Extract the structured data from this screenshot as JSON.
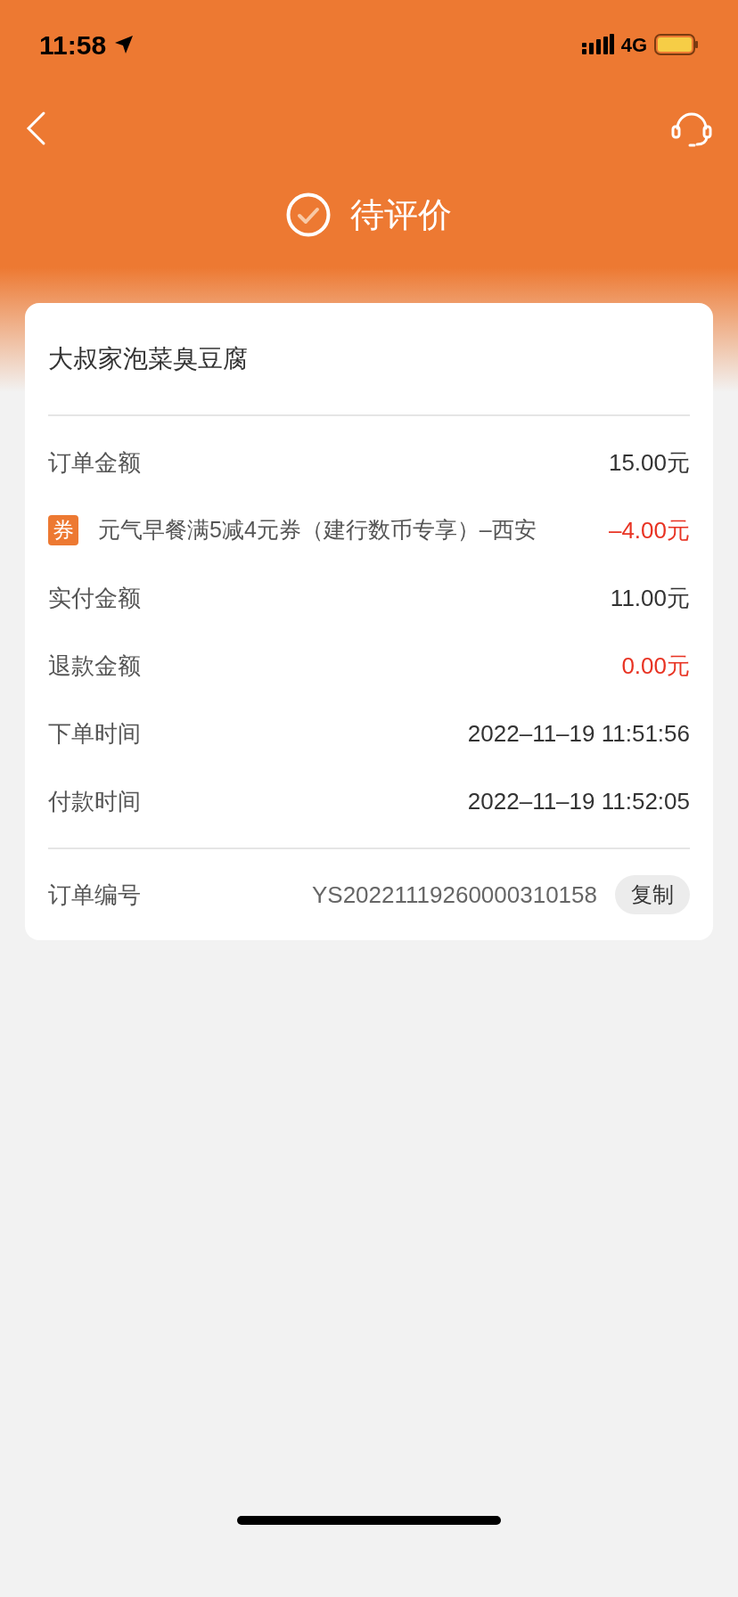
{
  "status_bar": {
    "time": "11:58",
    "network": "4G"
  },
  "header": {
    "status": "待评价"
  },
  "order": {
    "shop_name": "大叔家泡菜臭豆腐",
    "rows": [
      {
        "kind": "amount",
        "label": "订单金额",
        "value": "15.00元",
        "highlight": false
      },
      {
        "kind": "coupon",
        "badge": "券",
        "label": "元气早餐满5减4元券（建行数币专享）–西安",
        "value": "–4.00元",
        "highlight": true
      },
      {
        "kind": "amount",
        "label": "实付金额",
        "value": "11.00元",
        "highlight": false
      },
      {
        "kind": "amount",
        "label": "退款金额",
        "value": "0.00元",
        "highlight": true
      },
      {
        "kind": "amount",
        "label": "下单时间",
        "value": "2022–11–19 11:51:56",
        "highlight": false
      },
      {
        "kind": "amount",
        "label": "付款时间",
        "value": "2022–11–19 11:52:05",
        "highlight": false
      }
    ],
    "order_number": {
      "label": "订单编号",
      "value": "YS20221119260000310158",
      "button": "复制"
    }
  }
}
